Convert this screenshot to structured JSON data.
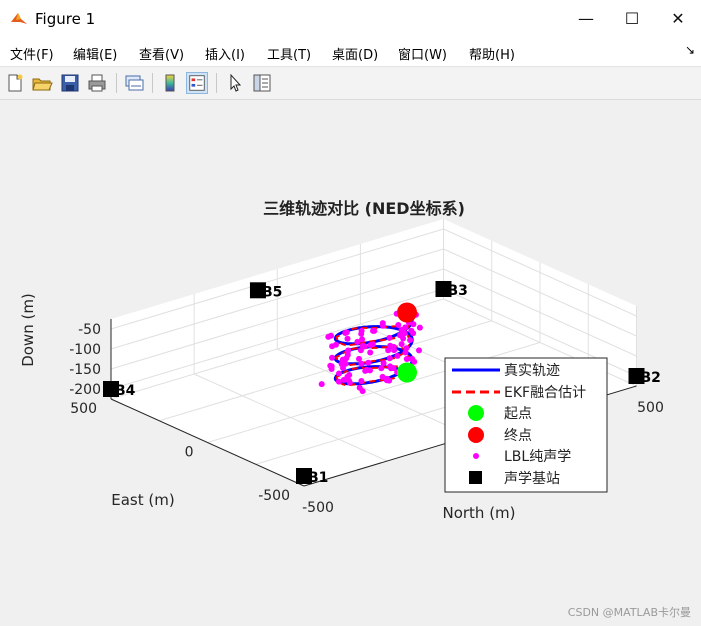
{
  "window": {
    "title": "Figure 1",
    "controls": {
      "minimize": "—",
      "maximize": "☐",
      "close": "✕"
    }
  },
  "menu": {
    "items": [
      "文件(F)",
      "编辑(E)",
      "查看(V)",
      "插入(I)",
      "工具(T)",
      "桌面(D)",
      "窗口(W)",
      "帮助(H)"
    ],
    "overflow": "↘"
  },
  "toolbar": {
    "icons": [
      "new-figure-icon",
      "open-icon",
      "save-icon",
      "print-icon",
      "link-plot-icon",
      "colorbar-icon",
      "legend-icon",
      "pointer-icon",
      "property-inspector-icon"
    ],
    "active": "legend-icon"
  },
  "chart_data": {
    "type": "line3d",
    "title": "三维轨迹对比 (NED坐标系)",
    "xlabel": "North (m)",
    "ylabel": "East (m)",
    "zlabel": "Down (m)",
    "xticks": [
      "-500",
      "500"
    ],
    "yticks": [
      "500",
      "0",
      "-500"
    ],
    "zticks": [
      "-50",
      "-100",
      "-150",
      "-200"
    ],
    "xlim": [
      -500,
      500
    ],
    "ylim": [
      -500,
      500
    ],
    "zlim": [
      -225,
      -25
    ],
    "z_reversed": true,
    "grid": true,
    "legend_position": "bottom-right",
    "colors": {
      "true": "#0000ff",
      "ekf": "#ff0000",
      "start": "#00ff00",
      "end": "#ff0000",
      "lbl": "#ff00ff",
      "station": "#000000"
    },
    "legend": [
      "真实轨迹",
      "EKF融合估计",
      "起点",
      "终点",
      "LBL纯声学",
      "声学基站"
    ],
    "trajectory": {
      "radius": 100,
      "z_start": -200,
      "z_end": -50,
      "turns": 3
    },
    "start": {
      "x": 100,
      "y": 0,
      "z": -200
    },
    "end": {
      "x": 100,
      "y": 0,
      "z": -50
    },
    "stations": [
      {
        "label": "B1",
        "x": -500,
        "y": -500,
        "z": -200
      },
      {
        "label": "B2",
        "x": 500,
        "y": -500,
        "z": -200
      },
      {
        "label": "B3",
        "x": 500,
        "y": 500,
        "z": -200
      },
      {
        "label": "B4",
        "x": -500,
        "y": 500,
        "z": -200
      },
      {
        "label": "B5",
        "x": 0,
        "y": 600,
        "z": -100
      }
    ]
  },
  "watermark": "CSDN @MATLAB卡尔曼"
}
